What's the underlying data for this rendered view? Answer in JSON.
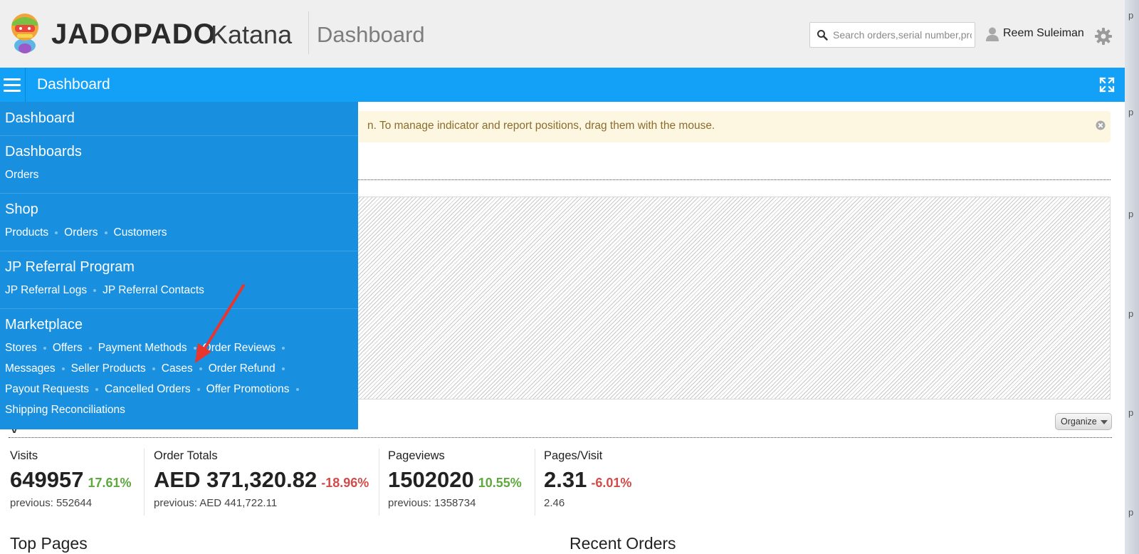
{
  "header": {
    "brand": "JADOPADO",
    "product": "Katana",
    "page_heading": "Dashboard",
    "search_placeholder": "Search orders,serial number,pro",
    "user_name": "Reem Suleiman",
    "icons": [
      "logo-mascot-icon",
      "search-icon",
      "user-icon",
      "gear-icon"
    ]
  },
  "bluebar": {
    "title": "Dashboard",
    "icons": [
      "hamburger-menu-icon",
      "expand-icon"
    ]
  },
  "notice": {
    "text": "n. To manage indicator and report positions, drag them with the mouse."
  },
  "organize_label": "Organize",
  "partial_heading": "y",
  "stats": [
    {
      "label": "Visits",
      "value": "649957",
      "change": "17.61%",
      "trend": "up",
      "previous": "previous: 552644"
    },
    {
      "label": "Order Totals",
      "value": "AED 371,320.82",
      "change": "-18.96%",
      "trend": "down",
      "previous": "previous: AED 441,722.11"
    },
    {
      "label": "Pageviews",
      "value": "1502020",
      "change": "10.55%",
      "trend": "up",
      "previous": "previous: 1358734"
    },
    {
      "label": "Pages/Visit",
      "value": "2.31",
      "change": "-6.01%",
      "trend": "down",
      "previous": "2.46"
    }
  ],
  "sections": {
    "top_pages": "Top Pages",
    "recent_orders": "Recent Orders"
  },
  "nav_menu": {
    "dashboard": "Dashboard",
    "dashboards": {
      "title": "Dashboards",
      "links": [
        "Orders"
      ]
    },
    "shop": {
      "title": "Shop",
      "links": [
        "Products",
        "Orders",
        "Customers"
      ]
    },
    "referral": {
      "title": "JP Referral Program",
      "links": [
        "JP Referral Logs",
        "JP Referral Contacts"
      ]
    },
    "marketplace": {
      "title": "Marketplace",
      "links": [
        "Stores",
        "Offers",
        "Payment Methods",
        "Order Reviews",
        "Messages",
        "Seller Products",
        "Cases",
        "Order Refund",
        "Payout Requests",
        "Cancelled Orders",
        "Offer Promotions",
        "Shipping Reconciliations"
      ]
    }
  },
  "colors": {
    "bluebar": "#13a1f7",
    "nav_panel": "#188fdf",
    "positive": "#5ea83d",
    "negative": "#d24b4b",
    "notice_bg": "#fdf7e2",
    "arrow": "#e8362f"
  },
  "edge_glyph": "p"
}
